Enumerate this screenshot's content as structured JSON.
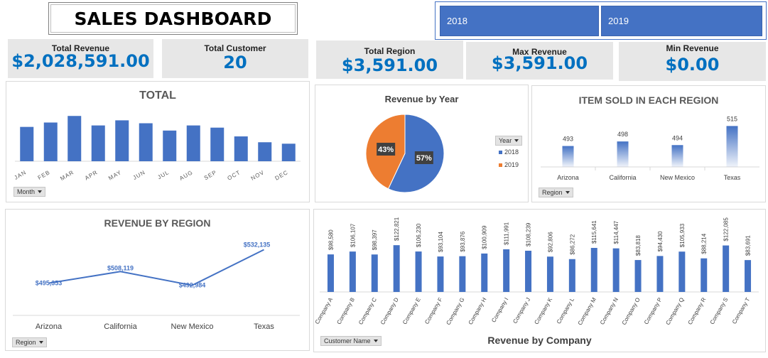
{
  "title": "SALES DASHBOARD",
  "year_slicer": {
    "items": [
      "2018",
      "2019"
    ],
    "accent": "#4472c4"
  },
  "kpis": {
    "total_revenue": {
      "label": "Total Revenue",
      "value": "$2,028,591.00"
    },
    "total_customer": {
      "label": "Total Customer",
      "value": "20"
    },
    "total_region": {
      "label": "Total Region",
      "value": "$3,591.00"
    },
    "max_revenue": {
      "label": "Max Revenue",
      "value": "$3,591.00"
    },
    "min_revenue": {
      "label": "Min Revenue",
      "value": "$0.00"
    }
  },
  "field_buttons": {
    "month": "Month",
    "year": "Year",
    "region_items": "Region",
    "region_revenue": "Region",
    "customer": "Customer Name"
  },
  "chart_data": [
    {
      "id": "total",
      "type": "bar",
      "title": "TOTAL",
      "categories": [
        "JAN",
        "FEB",
        "MAR",
        "APR",
        "MAY",
        "JUN",
        "JUL",
        "AUG",
        "SEP",
        "OCT",
        "NOV",
        "DEC"
      ],
      "values": [
        47,
        53,
        62,
        49,
        56,
        52,
        42,
        49,
        46,
        34,
        26,
        24
      ],
      "ylim": [
        0,
        70
      ],
      "color": "#4472c4"
    },
    {
      "id": "revenue_by_year",
      "type": "pie",
      "title": "Revenue by Year",
      "categories": [
        "2018",
        "2019"
      ],
      "values": [
        57,
        43
      ],
      "labels": [
        "57%",
        "43%"
      ],
      "colors": [
        "#4472c4",
        "#ed7d31"
      ],
      "legend": "right"
    },
    {
      "id": "items_by_region",
      "type": "bar",
      "title": "ITEM SOLD IN EACH REGION",
      "categories": [
        "Arizona",
        "California",
        "New Mexico",
        "Texas"
      ],
      "values": [
        493,
        498,
        494,
        515
      ],
      "data_labels": [
        "493",
        "498",
        "494",
        "515"
      ],
      "ylim": [
        470,
        520
      ],
      "color": "#4472c4"
    },
    {
      "id": "revenue_by_region",
      "type": "line",
      "title": "REVENUE BY REGION",
      "categories": [
        "Arizona",
        "California",
        "New Mexico",
        "Texas"
      ],
      "values": [
        495353,
        508119,
        492984,
        532135
      ],
      "data_labels": [
        "$495,353",
        "$508,119",
        "$492,984",
        "$532,135"
      ],
      "ylim": [
        460000,
        545000
      ],
      "color": "#4472c4"
    },
    {
      "id": "revenue_by_company",
      "type": "bar",
      "title": "Revenue by Company",
      "categories": [
        "Company A",
        "Company B",
        "Company C",
        "Company D",
        "Company E",
        "Company F",
        "Company G",
        "Company H",
        "Company I",
        "Company J",
        "Company K",
        "Company L",
        "Company M",
        "Company N",
        "Company O",
        "Company P",
        "Company Q",
        "Company R",
        "Company S",
        "Company T"
      ],
      "values": [
        98580,
        106107,
        98397,
        122821,
        106230,
        93104,
        93876,
        100909,
        111991,
        108239,
        92806,
        86272,
        115641,
        114447,
        83818,
        94430,
        105933,
        88214,
        122085,
        83691
      ],
      "data_labels": [
        "$98,580",
        "$106,107",
        "$98,397",
        "$122,821",
        "$106,230",
        "$93,104",
        "$93,876",
        "$100,909",
        "$111,991",
        "$108,239",
        "$92,806",
        "$86,272",
        "$115,641",
        "$114,447",
        "$83,818",
        "$94,430",
        "$105,933",
        "$88,214",
        "$122,085",
        "$83,691"
      ],
      "ylim": [
        0,
        125000
      ],
      "color": "#4472c4"
    }
  ]
}
